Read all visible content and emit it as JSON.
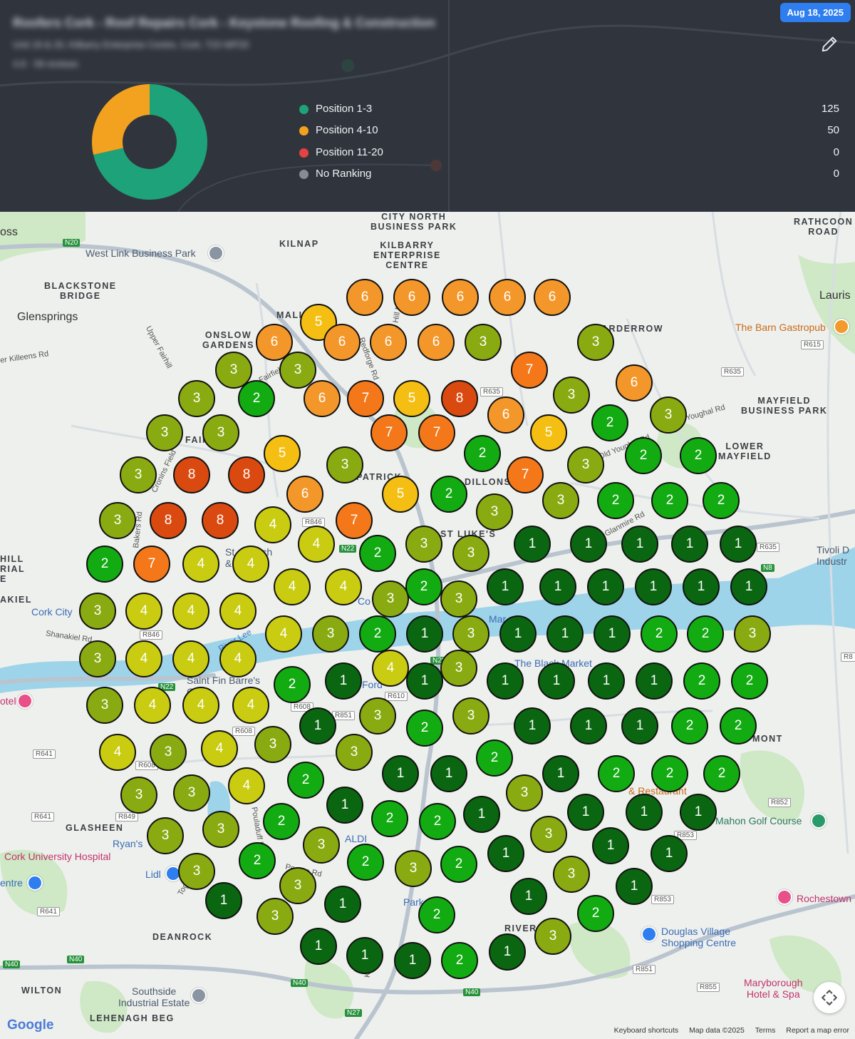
{
  "header": {
    "business_name": "Roofers Cork - Roof Repairs Cork - Keystone Roofing & Construction",
    "address": "Unit 19 & 20, Kilbarry Enterprise Centre, Cork, T23 WP20",
    "rating": "4.9 · 59 reviews",
    "date_badge": "Aug 18, 2025",
    "edit_icon": "pencil-icon",
    "legend": [
      {
        "label": "Position 1-3",
        "count": "125",
        "color": "#1ea27a"
      },
      {
        "label": "Position 4-10",
        "count": "50",
        "color": "#f2a21e"
      },
      {
        "label": "Position 11-20",
        "count": "0",
        "color": "#e54242"
      },
      {
        "label": "No Ranking",
        "count": "0",
        "color": "#868c94"
      }
    ]
  },
  "map": {
    "places_caps": [
      "CITY NORTH\nBUSINESS PARK",
      "KILNAP",
      "KILBARRY\nENTERPRISE\nCENTRE",
      "RATHCOON\nROAD",
      "BLACKSTONE\nBRIDGE",
      "ONSLOW\nGARDENS",
      "ARDERROW",
      "MAYFIELD\nBUSINESS PARK",
      "LOWER\nMAYFIELD",
      "GLASHEEN",
      "DEANROCK",
      "WILTON",
      "LEHENAGH BEG",
      "MALL",
      "DILLONS",
      "RIVER",
      "FAIR",
      "ST LUKE'S",
      "PATRICK",
      "MONT",
      "AKIEL",
      "HILL\nRIAL\nE"
    ],
    "places_town": [
      "Glensprings",
      "Lauris",
      "oss"
    ],
    "places_poi": [
      "West Link Business Park",
      "Cork City",
      "Southside\nIndustrial Estate",
      "Tivoli D\nIndustr",
      "The Black Market",
      "Douglas Village\nShopping Centre",
      "Mahon Golf Course",
      "Ryan's",
      "Lidl",
      "ALDI",
      "Saint Fin Barre's\nCath",
      "St  Church\n& Tower",
      "The Barn Gastropub",
      "Cork University Hospital",
      "Rochestown",
      "Maryborough\nHotel & Spa",
      "otel",
      "entre",
      "Shanakiel Rd",
      "River Lee",
      "& Restaurant",
      "Kinsale",
      "er Killeens Rd",
      "Upper Fairhill",
      "Cronins Field",
      "Bakers Rd",
      "Glanmire Rd",
      "Old Youghal Rd",
      "Youghal Rd",
      "Pouladuff Rd",
      "Togher Rd",
      "Fairfield",
      "Redforge Rd",
      "Jn Hill Middle",
      "Pearse Rd",
      "Ford",
      "Park",
      "Mar",
      "Co"
    ],
    "road_labels": [
      "N20",
      "R635",
      "R615",
      "R635",
      "R846",
      "R846",
      "R610",
      "R608",
      "R608",
      "R641",
      "R608",
      "R849",
      "R641",
      "R641",
      "R851",
      "R852",
      "R853",
      "R853",
      "R851",
      "R855",
      "R635",
      "R8",
      "N8",
      "N22",
      "N22",
      "N27",
      "N40",
      "N40",
      "N40",
      "N40",
      "N28"
    ],
    "footer": {
      "google": "Google",
      "shortcuts": "Keyboard shortcuts",
      "map_data": "Map data ©2025",
      "terms": "Terms",
      "report": "Report a map error"
    }
  },
  "markers": [
    {
      "rank": "6"
    },
    {
      "rank": "6"
    },
    {
      "rank": "6"
    },
    {
      "rank": "6"
    },
    {
      "rank": "6"
    },
    {
      "rank": "5"
    },
    {
      "rank": "6"
    },
    {
      "rank": "6"
    },
    {
      "rank": "6"
    },
    {
      "rank": "6"
    },
    {
      "rank": "3"
    },
    {
      "rank": "3"
    },
    {
      "rank": "3"
    },
    {
      "rank": "3"
    },
    {
      "rank": "7"
    },
    {
      "rank": "6"
    },
    {
      "rank": "3"
    },
    {
      "rank": "3"
    },
    {
      "rank": "2"
    },
    {
      "rank": "6"
    },
    {
      "rank": "7"
    },
    {
      "rank": "5"
    },
    {
      "rank": "8"
    },
    {
      "rank": "6"
    },
    {
      "rank": "3"
    },
    {
      "rank": "2"
    },
    {
      "rank": "3"
    },
    {
      "rank": "3"
    },
    {
      "rank": "7"
    },
    {
      "rank": "7"
    },
    {
      "rank": "5"
    },
    {
      "rank": "5"
    },
    {
      "rank": "2"
    },
    {
      "rank": "2"
    },
    {
      "rank": "2"
    },
    {
      "rank": "3"
    },
    {
      "rank": "3"
    },
    {
      "rank": "3"
    },
    {
      "rank": "8"
    },
    {
      "rank": "8"
    },
    {
      "rank": "7"
    },
    {
      "rank": "6"
    },
    {
      "rank": "5"
    },
    {
      "rank": "2"
    },
    {
      "rank": "2"
    },
    {
      "rank": "2"
    },
    {
      "rank": "2"
    },
    {
      "rank": "3"
    },
    {
      "rank": "3"
    },
    {
      "rank": "3"
    },
    {
      "rank": "8"
    },
    {
      "rank": "8"
    },
    {
      "rank": "7"
    },
    {
      "rank": "4"
    },
    {
      "rank": "4"
    },
    {
      "rank": "3"
    },
    {
      "rank": "1"
    },
    {
      "rank": "1"
    },
    {
      "rank": "1"
    },
    {
      "rank": "1"
    },
    {
      "rank": "1"
    },
    {
      "rank": "2"
    },
    {
      "rank": "3"
    },
    {
      "rank": "2"
    },
    {
      "rank": "7"
    },
    {
      "rank": "4"
    },
    {
      "rank": "4"
    },
    {
      "rank": "4"
    },
    {
      "rank": "4"
    },
    {
      "rank": "2"
    },
    {
      "rank": "1"
    },
    {
      "rank": "1"
    },
    {
      "rank": "1"
    },
    {
      "rank": "1"
    },
    {
      "rank": "1"
    },
    {
      "rank": "1"
    },
    {
      "rank": "3"
    },
    {
      "rank": "3"
    },
    {
      "rank": "3"
    },
    {
      "rank": "4"
    },
    {
      "rank": "4"
    },
    {
      "rank": "4"
    },
    {
      "rank": "4"
    },
    {
      "rank": "3"
    },
    {
      "rank": "2"
    },
    {
      "rank": "1"
    },
    {
      "rank": "3"
    },
    {
      "rank": "1"
    },
    {
      "rank": "1"
    },
    {
      "rank": "1"
    },
    {
      "rank": "2"
    },
    {
      "rank": "2"
    },
    {
      "rank": "3"
    },
    {
      "rank": "3"
    },
    {
      "rank": "4"
    },
    {
      "rank": "4"
    },
    {
      "rank": "4"
    },
    {
      "rank": "4"
    },
    {
      "rank": "3"
    },
    {
      "rank": "1"
    },
    {
      "rank": "1"
    },
    {
      "rank": "1"
    },
    {
      "rank": "1"
    },
    {
      "rank": "1"
    },
    {
      "rank": "1"
    },
    {
      "rank": "2"
    },
    {
      "rank": "2"
    },
    {
      "rank": "2"
    },
    {
      "rank": "3"
    },
    {
      "rank": "4"
    },
    {
      "rank": "4"
    },
    {
      "rank": "4"
    },
    {
      "rank": "3"
    },
    {
      "rank": "3"
    },
    {
      "rank": "1"
    },
    {
      "rank": "1"
    },
    {
      "rank": "1"
    },
    {
      "rank": "1"
    },
    {
      "rank": "2"
    },
    {
      "rank": "2"
    },
    {
      "rank": "2"
    },
    {
      "rank": "3"
    },
    {
      "rank": "4"
    },
    {
      "rank": "4"
    },
    {
      "rank": "3"
    },
    {
      "rank": "3"
    },
    {
      "rank": "2"
    },
    {
      "rank": "1"
    },
    {
      "rank": "1"
    },
    {
      "rank": "1"
    },
    {
      "rank": "2"
    },
    {
      "rank": "2"
    },
    {
      "rank": "2"
    },
    {
      "rank": "2"
    },
    {
      "rank": "4"
    },
    {
      "rank": "3"
    },
    {
      "rank": "3"
    },
    {
      "rank": "3"
    },
    {
      "rank": "1"
    },
    {
      "rank": "1"
    },
    {
      "rank": "1"
    },
    {
      "rank": "1"
    },
    {
      "rank": "1"
    },
    {
      "rank": "2"
    },
    {
      "rank": "2"
    },
    {
      "rank": "2"
    },
    {
      "rank": "3"
    },
    {
      "rank": "3"
    },
    {
      "rank": "3"
    },
    {
      "rank": "3"
    },
    {
      "rank": "1"
    },
    {
      "rank": "1"
    },
    {
      "rank": "1"
    },
    {
      "rank": "2"
    },
    {
      "rank": "2"
    },
    {
      "rank": "2"
    },
    {
      "rank": "3"
    },
    {
      "rank": "3"
    },
    {
      "rank": "3"
    },
    {
      "rank": "3"
    },
    {
      "rank": "1"
    },
    {
      "rank": "1"
    },
    {
      "rank": "1"
    },
    {
      "rank": "1"
    },
    {
      "rank": "2"
    },
    {
      "rank": "2"
    },
    {
      "rank": "3"
    },
    {
      "rank": "3"
    },
    {
      "rank": "1"
    },
    {
      "rank": "1"
    },
    {
      "rank": "1"
    },
    {
      "rank": "1"
    },
    {
      "rank": "2"
    },
    {
      "rank": "3"
    },
    {
      "rank": "2"
    },
    {
      "rank": "1"
    },
    {
      "rank": "1"
    },
    {
      "rank": "1"
    }
  ],
  "rank_colors": {
    "1": "#0a6610",
    "2": "#12ab12",
    "3": "#8aaa12",
    "4": "#c9cc10",
    "5": "#f4bf12",
    "6": "#f4972a",
    "7": "#f4781a",
    "8": "#da4a10"
  }
}
